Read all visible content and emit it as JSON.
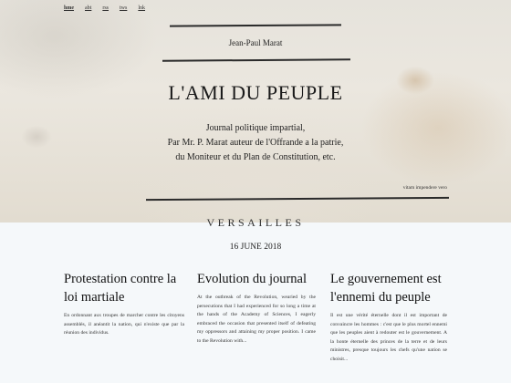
{
  "nav": {
    "items": [
      "hme",
      "abt",
      "rss",
      "tws",
      "lnk"
    ]
  },
  "header": {
    "author": "Jean-Paul Marat",
    "title": "L'AMI DU PEUPLE",
    "subtitle_lines": [
      "Journal politique impartial,",
      "Par Mr. P. Marat auteur de l'Offrande a la patrie,",
      "du Moniteur et du Plan de Constitution, etc."
    ],
    "motto": "vitam impendere vero"
  },
  "section": {
    "title": "VERSAILLES",
    "date": "16 JUNE 2018"
  },
  "articles": [
    {
      "title": "Protestation contre la loi martiale",
      "excerpt": "En ordonnant aux troupes de marcher contre les citoyens assemblés, il anéantit la nation, qui n'existe que par la réunion des individus."
    },
    {
      "title": "Evolution du journal",
      "excerpt": "At the outbreak of the Revolution, wearied by the persecutions that I had experienced for so long a time at the hands of the Academy of Sciences, I eagerly embraced the occasion that presented itself of defeating my oppressors and attaining my proper position. I came to the Revolution with..."
    },
    {
      "title": "Le gouvernement est l'ennemi du peuple",
      "excerpt": "Il est une vérité éternelle dont il est important de convaincre les hommes : c'est que le plus mortel ennemi que les peuples aient à redouter est le gouvernement. A la honte éternelle des princes de la terre et de leurs ministres, presque toujours les chefs qu'une nation se choisit..."
    }
  ]
}
